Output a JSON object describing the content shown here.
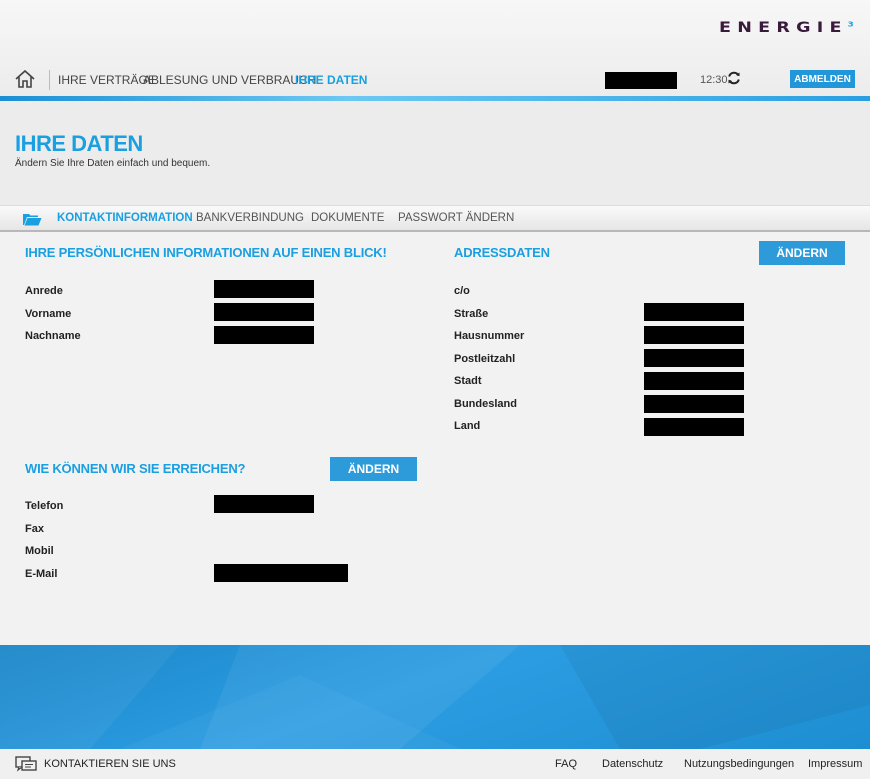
{
  "brand": {
    "logo_text": "ENERGIE",
    "logo_sup": "3"
  },
  "nav": {
    "items": [
      "IHRE VERTRÄGE",
      "ABLESUNG UND VERBRAUCH",
      "IHRE DATEN"
    ],
    "time": "12:30",
    "logout_label": "ABMELDEN"
  },
  "page": {
    "title": "IHRE DATEN",
    "subtitle": "Ändern Sie Ihre Daten einfach und bequem."
  },
  "tabs": [
    "KONTAKTINFORMATION",
    "BANKVERBINDUNG",
    "DOKUMENTE",
    "PASSWORT ÄNDERN"
  ],
  "personal": {
    "title": "IHRE PERSÖNLICHEN INFORMATIONEN AUF EINEN BLICK!",
    "fields": [
      "Anrede",
      "Vorname",
      "Nachname"
    ]
  },
  "contact": {
    "title": "WIE KÖNNEN WIR SIE ERREICHEN?",
    "edit_label": "ÄNDERN",
    "fields": [
      "Telefon",
      "Fax",
      "Mobil",
      "E-Mail"
    ]
  },
  "address": {
    "title": "ADRESSDATEN",
    "edit_label": "ÄNDERN",
    "fields": [
      "c/o",
      "Straße",
      "Hausnummer",
      "Postleitzahl",
      "Stadt",
      "Bundesland",
      "Land"
    ]
  },
  "footer": {
    "contact_label": "KONTAKTIEREN SIE UNS",
    "links": [
      "FAQ",
      "Datenschutz",
      "Nutzungsbedingungen",
      "Impressum"
    ]
  },
  "colors": {
    "accent": "#1a9fe0",
    "button": "#2d9ad9",
    "band": "#2196d8",
    "redaction": "#000000"
  },
  "icons": [
    "home-icon",
    "refresh-icon",
    "folder-open-icon",
    "chat-bubbles-icon"
  ]
}
